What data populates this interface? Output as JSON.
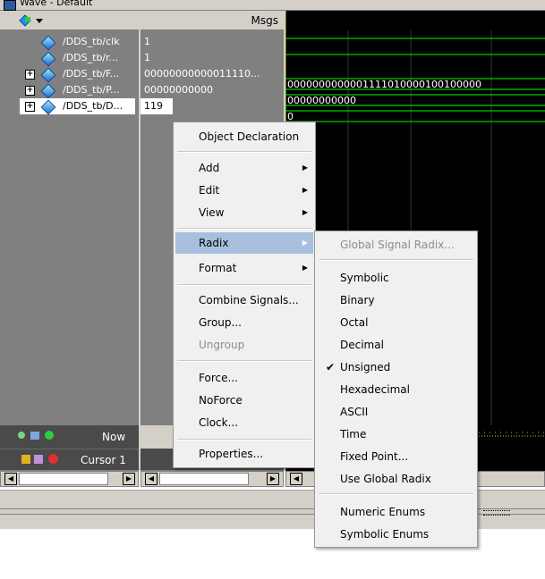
{
  "window": {
    "title": "Wave - Default"
  },
  "headers": {
    "msgs": "Msgs"
  },
  "signals": [
    {
      "name": "/DDS_tb/clk",
      "value": "1",
      "expandable": false
    },
    {
      "name": "/DDS_tb/r...",
      "value": "1",
      "expandable": false
    },
    {
      "name": "/DDS_tb/F...",
      "value": "00000000000011110...",
      "expandable": true
    },
    {
      "name": "/DDS_tb/P...",
      "value": "00000000000",
      "expandable": true
    },
    {
      "name": "/DDS_tb/D...",
      "value": "119",
      "expandable": true
    }
  ],
  "wave": {
    "bus1": "0000000000001111010000100100000",
    "bus2": "00000000000",
    "bus3": "0"
  },
  "status": {
    "now": "Now",
    "cursor": "Cursor 1"
  },
  "context_menu": {
    "items": [
      {
        "label": "Object Declaration",
        "submenu": false,
        "disabled": false
      },
      {
        "label": "Add",
        "submenu": true,
        "disabled": false
      },
      {
        "label": "Edit",
        "submenu": true,
        "disabled": false
      },
      {
        "label": "View",
        "submenu": true,
        "disabled": false
      },
      {
        "label": "Radix",
        "submenu": true,
        "disabled": false,
        "highlighted": true
      },
      {
        "label": "Format",
        "submenu": true,
        "disabled": false
      },
      {
        "label": "Combine Signals...",
        "submenu": false,
        "disabled": false
      },
      {
        "label": "Group...",
        "submenu": false,
        "disabled": false
      },
      {
        "label": "Ungroup",
        "submenu": false,
        "disabled": true
      },
      {
        "label": "Force...",
        "submenu": false,
        "disabled": false
      },
      {
        "label": "NoForce",
        "submenu": false,
        "disabled": false
      },
      {
        "label": "Clock...",
        "submenu": false,
        "disabled": false
      },
      {
        "label": "Properties...",
        "submenu": false,
        "disabled": false
      }
    ]
  },
  "radix_menu": {
    "items": [
      {
        "label": "Global Signal Radix...",
        "disabled": true,
        "checked": false
      },
      {
        "label": "Symbolic",
        "disabled": false,
        "checked": false
      },
      {
        "label": "Binary",
        "disabled": false,
        "checked": false
      },
      {
        "label": "Octal",
        "disabled": false,
        "checked": false
      },
      {
        "label": "Decimal",
        "disabled": false,
        "checked": false
      },
      {
        "label": "Unsigned",
        "disabled": false,
        "checked": true
      },
      {
        "label": "Hexadecimal",
        "disabled": false,
        "checked": false
      },
      {
        "label": "ASCII",
        "disabled": false,
        "checked": false
      },
      {
        "label": "Time",
        "disabled": false,
        "checked": false
      },
      {
        "label": "Fixed Point...",
        "disabled": false,
        "checked": false
      },
      {
        "label": "Use Global Radix",
        "disabled": false,
        "checked": false
      },
      {
        "label": "Numeric Enums",
        "disabled": false,
        "checked": false
      },
      {
        "label": "Symbolic Enums",
        "disabled": false,
        "checked": false
      }
    ]
  },
  "colors": {
    "accent": "#a8c0dd",
    "wave_green": "#00ff00",
    "pane_gray": "#808080"
  }
}
